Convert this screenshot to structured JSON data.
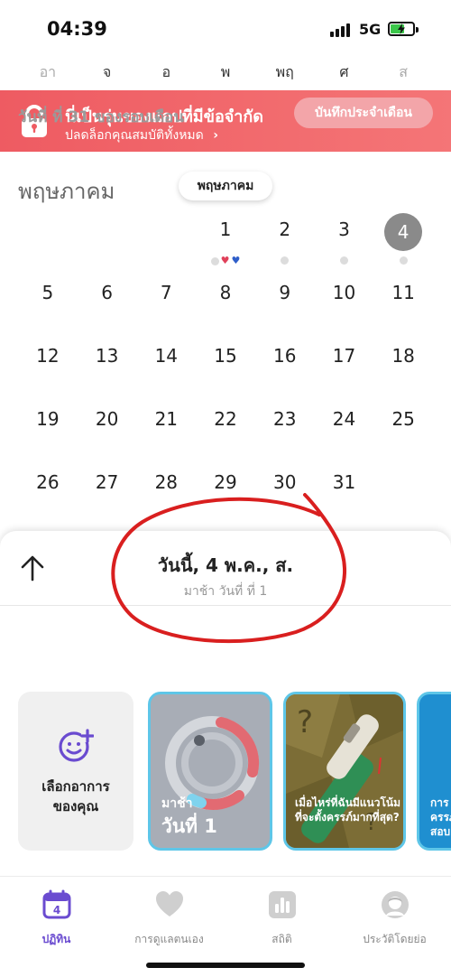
{
  "status_bar": {
    "time": "04:39",
    "network": "5G",
    "battery_state": "charging"
  },
  "weekdays": [
    "อา",
    "จ",
    "อ",
    "พ",
    "พฤ",
    "ศ",
    "ส"
  ],
  "banner": {
    "title": "นี่เป็นรุ่นของแอปที่มีข้อจำกัด",
    "subtitle": "ปลดล็อกคุณสมบัติทั้งหมด",
    "subtitle_chevron": "›",
    "close": "✕"
  },
  "calendar": {
    "month_title": "พฤษภาคม",
    "month_pill": "พฤษภาคม",
    "weeks": [
      [
        "",
        "",
        "",
        "1",
        "2",
        "3",
        "4"
      ],
      [
        "5",
        "6",
        "7",
        "8",
        "9",
        "10",
        "11"
      ],
      [
        "12",
        "13",
        "14",
        "15",
        "16",
        "17",
        "18"
      ],
      [
        "19",
        "20",
        "21",
        "22",
        "23",
        "24",
        "25"
      ],
      [
        "26",
        "27",
        "28",
        "29",
        "30",
        "31",
        ""
      ]
    ],
    "today": "4"
  },
  "sheet": {
    "date_label": "วันนี้, 4 พ.ค., ส.",
    "sub_label": "มาช้า วันที่ ที่ 1",
    "cycle_day": "วันที่ ที่ 31 ของรอบเดือน",
    "log_button": "บันทึกประจำเดือน"
  },
  "cards": {
    "symptom_label_1": "เลือกอาการ",
    "symptom_label_2": "ของคุณ",
    "period_top": "มาช้า",
    "period_day": "วันที่ 1",
    "article_text": "เมื่อไหร่ที่ฉันมีแนวโน้มที่จะตั้งครรภ์มากที่สุด?",
    "next_text_1": "การ",
    "next_text_2": "ครรภ",
    "next_text_3": "สอบ"
  },
  "tabs": [
    {
      "label": "ปฏิทิน",
      "icon": "calendar-icon",
      "active": true,
      "badge": "4"
    },
    {
      "label": "การดูแลตนเอง",
      "icon": "heart-icon",
      "active": false
    },
    {
      "label": "สถิติ",
      "icon": "stats-icon",
      "active": false
    },
    {
      "label": "ประวัติโดยย่อ",
      "icon": "profile-icon",
      "active": false
    }
  ],
  "colors": {
    "banner": "#ee5b62",
    "accent": "#6a4bd0",
    "today_circle": "#8a8a8a",
    "card_border": "#5ec6e8",
    "log_button": "#f3a5a9"
  }
}
